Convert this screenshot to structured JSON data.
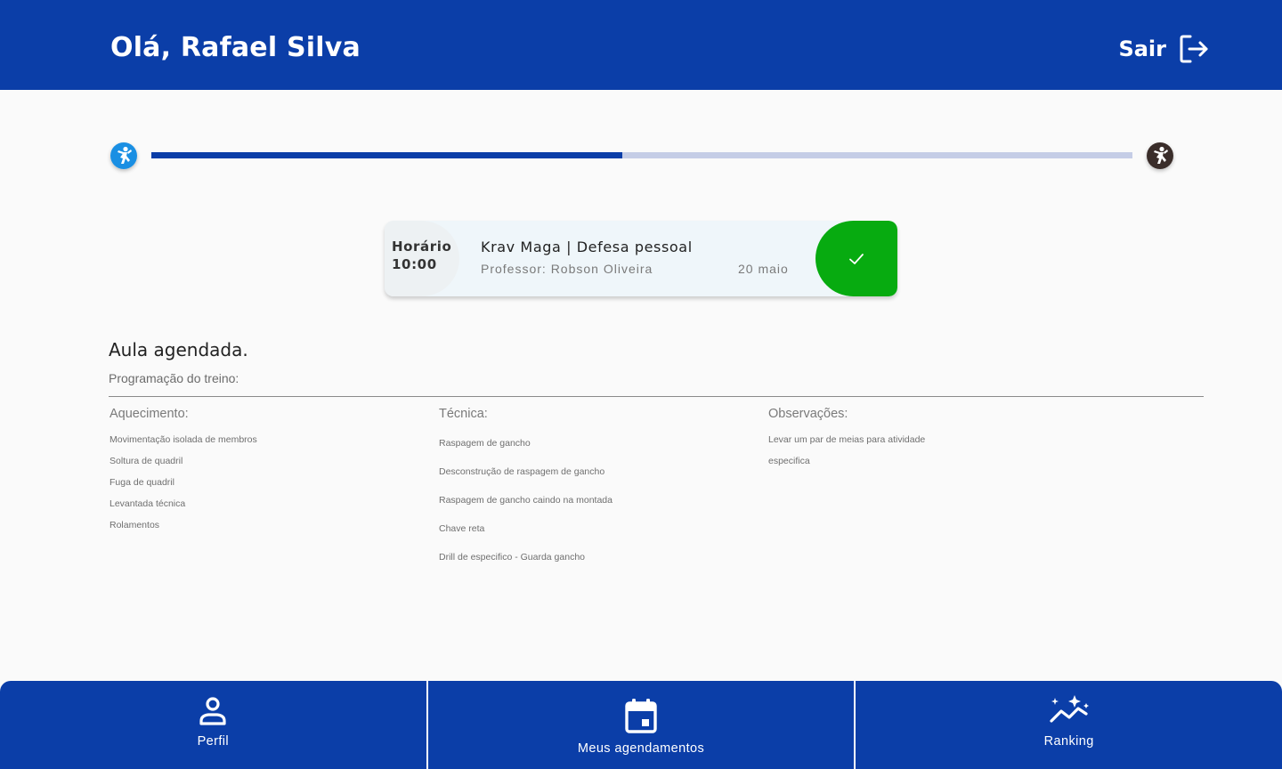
{
  "header": {
    "greeting": "Olá, Rafael Silva",
    "logout_label": "Sair",
    "logout_icon": "logout-icon"
  },
  "progress": {
    "start_icon": "martial-artist-icon",
    "end_icon": "martial-artist-icon",
    "fraction": 0.48,
    "start_color": "#1a8fe3",
    "end_color": "#3a2d2a",
    "fill_color": "#0b3ea8",
    "track_color": "#c5cde6"
  },
  "class_card": {
    "time_label": "Horário",
    "time_value": "10:00",
    "title": "Krav Maga | Defesa pessoal",
    "teacher": "Professor: Robson Oliveira",
    "date": "20 maio",
    "confirm_icon": "check-icon",
    "confirm_color": "#07ab10"
  },
  "schedule": {
    "status": "Aula agendada.",
    "program_label": "Programação do treino:",
    "warmup": {
      "title": "Aquecimento:",
      "items": [
        "Movimentação isolada de membros",
        "Soltura de quadril",
        "Fuga de quadril",
        "Levantada técnica",
        "Rolamentos"
      ]
    },
    "technique": {
      "title": "Técnica:",
      "items": [
        "Raspagem de gancho",
        "Desconstrução de raspagem de gancho",
        "Raspagem de gancho caindo na montada",
        "Chave reta",
        "Drill de especifico - Guarda gancho"
      ]
    },
    "notes": {
      "title": "Observações:",
      "items": [
        "Levar um par de meias para atividade",
        "especifica"
      ]
    }
  },
  "nav": {
    "items": [
      {
        "label": "Perfil",
        "icon": "user-icon"
      },
      {
        "label": "Meus agendamentos",
        "icon": "calendar-icon"
      },
      {
        "label": "Ranking",
        "icon": "trending-sparkle-icon"
      }
    ]
  },
  "colors": {
    "primary": "#0b3ea8",
    "background": "#fafafa"
  }
}
